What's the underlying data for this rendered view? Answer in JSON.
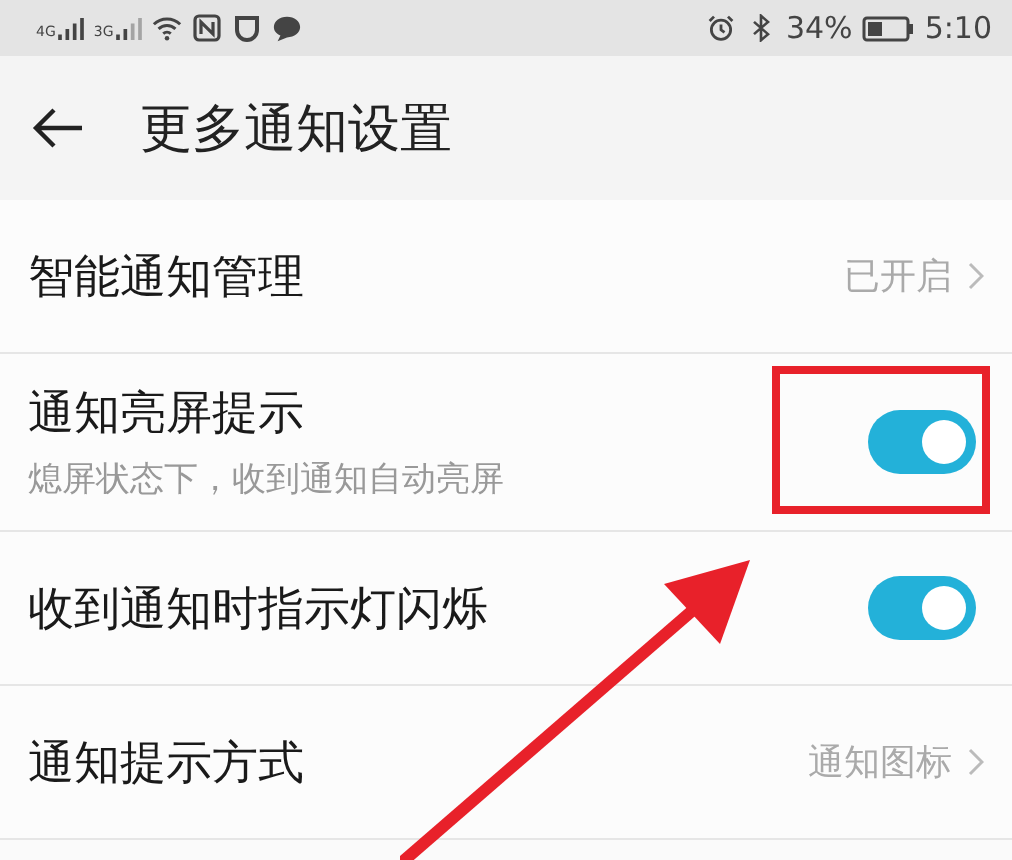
{
  "status_bar": {
    "network_1": "4G",
    "network_2": "3G",
    "battery": "34%",
    "time": "5:10"
  },
  "header": {
    "title": "更多通知设置"
  },
  "rows": [
    {
      "kind": "link",
      "label": "智能通知管理",
      "value": "已开启"
    },
    {
      "kind": "switch",
      "label": "通知亮屏提示",
      "subtitle": "熄屏状态下，收到通知自动亮屏",
      "on": true,
      "highlighted": true
    },
    {
      "kind": "switch",
      "label": "收到通知时指示灯闪烁",
      "on": true,
      "highlighted": false
    },
    {
      "kind": "link",
      "label": "通知提示方式",
      "value": "通知图标"
    }
  ]
}
